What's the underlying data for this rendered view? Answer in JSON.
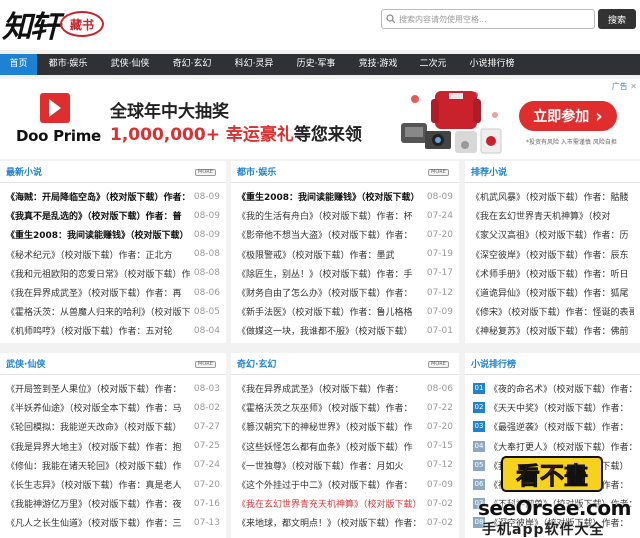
{
  "site": {
    "logo_text": "知轩",
    "logo_seal": "藏书"
  },
  "search": {
    "placeholder": "搜索内容请勿使用空格...",
    "button": "搜索"
  },
  "nav": [
    {
      "label": "首页",
      "active": true
    },
    {
      "label": "都市·娱乐"
    },
    {
      "label": "武侠·仙侠"
    },
    {
      "label": "奇幻·玄幻"
    },
    {
      "label": "科幻·灵异"
    },
    {
      "label": "历史·军事"
    },
    {
      "label": "竞技·游戏"
    },
    {
      "label": "二次元"
    },
    {
      "label": "小说排行榜"
    }
  ],
  "ad": {
    "badge": "广告",
    "brand": "Doo Prime",
    "line1": "全球年中大抽奖",
    "line2_highlight": "1,000,000+ 幸运豪礼",
    "line2_rest": "等您来领",
    "cta": "立即参加",
    "note": "*投资有风险 入市需谨慎 风险自担"
  },
  "more_label": "MORE",
  "panels": {
    "latest": {
      "title": "最新小说",
      "items": [
        {
          "title": "《海贼：开局降临空岛》（校对版下载）作者：",
          "date": "08-09",
          "bold": true
        },
        {
          "title": "《我真不是乱选的》（校对版下载）作者：普",
          "date": "08-09",
          "bold": true
        },
        {
          "title": "《重生2008：我间读能赚钱》（校对版下载）",
          "date": "08-09",
          "bold": true
        },
        {
          "title": "《秘术纪元》（校对版下载）作者：正北方",
          "date": "08-08"
        },
        {
          "title": "《我和元祖欧阳的恋爱日常》（校对版下载）作",
          "date": "08-08"
        },
        {
          "title": "《我在异界成武圣》（校对版下载）作者：再",
          "date": "08-06"
        },
        {
          "title": "《霍格沃茨：从兽魔人归来的哈利》（校对版下",
          "date": "08-05"
        },
        {
          "title": "《机师鸣哼》（校对版下载）作者：五对轮",
          "date": "08-04"
        }
      ]
    },
    "urban": {
      "title": "都市·娱乐",
      "items": [
        {
          "title": "《重生2008：我间读能赚钱》（校对版下载）",
          "date": "08-09",
          "bold": true
        },
        {
          "title": "《我的生活有舟白》（校对版下载）作者：杯",
          "date": "07-24"
        },
        {
          "title": "《影帝他不想当大盗》（校对版下载）作者：",
          "date": "07-20"
        },
        {
          "title": "《极限警戒》（校对版下载）作者：墨武",
          "date": "07-19"
        },
        {
          "title": "《除匠生，别丛！》（校对版下载）作者：手",
          "date": "07-17"
        },
        {
          "title": "《财务自由了怎么办》（校对版下载）作者：",
          "date": "07-12"
        },
        {
          "title": "《新手法医》（校对版下载）作者：鲁儿格格",
          "date": "07-09"
        },
        {
          "title": "《做媒这一块，我谁都不服》（校对版下载）",
          "date": "07-01"
        }
      ]
    },
    "recommend": {
      "title": "排荐小说",
      "items": [
        {
          "title": "《机武风暴》（校对版下载）作者：骷髅"
        },
        {
          "title": "《我在玄幻世界青天机神算》（校对"
        },
        {
          "title": "《家父汉高祖》（校对版下载）作者：历"
        },
        {
          "title": "《深空彼岸》（校对版下载）作者：辰东"
        },
        {
          "title": "《术师手册》（校对版下载）作者：听日"
        },
        {
          "title": "《道诡异仙》（校对版下载）作者：狐尾"
        },
        {
          "title": "《修宋》（校对版下载）作者：怪诞的表哥"
        },
        {
          "title": "《神秘复苏》（校对版下载）作者：佛前"
        }
      ]
    },
    "wuxia": {
      "title": "武侠·仙侠",
      "items": [
        {
          "title": "《开局签到圣人果位》（校对版下载）作者：",
          "date": "08-03"
        },
        {
          "title": "《半妖养仙途》（校对版全本下载）作者：马",
          "date": "08-02"
        },
        {
          "title": "《轮回模拟：我能逆天改命》（校对版下载）",
          "date": "07-27"
        },
        {
          "title": "《我是异界大地主》（校对版下载）作者：抱",
          "date": "07-25"
        },
        {
          "title": "《修仙：我能在诸天轮回》（校对版下载）作",
          "date": "07-24"
        },
        {
          "title": "《长生志异》（校对版下载）作者：真是老人",
          "date": "07-20"
        },
        {
          "title": "《我能神游亿万里》（校对版下载）作者：夜",
          "date": "07-16"
        },
        {
          "title": "《凡人之长生仙道》（校对版下载）作者：三",
          "date": "07-13"
        }
      ]
    },
    "fantasy": {
      "title": "奇幻·玄幻",
      "items": [
        {
          "title": "《我在异界成武圣》（校对版下载）作者：",
          "date": "08-06"
        },
        {
          "title": "《霍格沃茨之灰巫师》（校对版下载）作者：",
          "date": "07-22"
        },
        {
          "title": "《篡汉朝究下的神秘世界》（校对版下载）作",
          "date": "07-20"
        },
        {
          "title": "《这些妖怪怎么都有血条》（校对版下载）作",
          "date": "07-15"
        },
        {
          "title": "《一世独尊》（校对版下载）作者：月如火",
          "date": "07-12"
        },
        {
          "title": "《这个外挂过于中二》（校对版下载）作者：",
          "date": "07-09"
        },
        {
          "title": "《我在玄幻世界青充天机神算》（校对版下载）",
          "date": "07-02",
          "red": true
        },
        {
          "title": "《来地球，都文明点！》（校对版下载）作者：",
          "date": "07-02"
        }
      ]
    },
    "ranking": {
      "title": "小说排行榜",
      "items": [
        {
          "num": "01",
          "title": "《夜的命名术》（校对版下载）作者："
        },
        {
          "num": "02",
          "title": "《天天中奖》（校对版下载）作者："
        },
        {
          "num": "03",
          "title": "《最强逆袭》（校对版下载）作者："
        },
        {
          "num": "04",
          "title": "《大奉打更人》（校对版下载）作者："
        },
        {
          "num": "05",
          "title": "《我的模拟长生路》（校对版下载）"
        },
        {
          "num": "06",
          "title": "《神秘复苏》（校对版下载）作者："
        },
        {
          "num": "07",
          "title": "《不科学御兽》（校对版下载）作者："
        },
        {
          "num": "08",
          "title": "《深空彼岸》（校对版下载）作者："
        }
      ]
    }
  },
  "watermark": {
    "sign": "看不畫",
    "url": "seeOrsee.com",
    "sub": "手机app软件大全"
  }
}
